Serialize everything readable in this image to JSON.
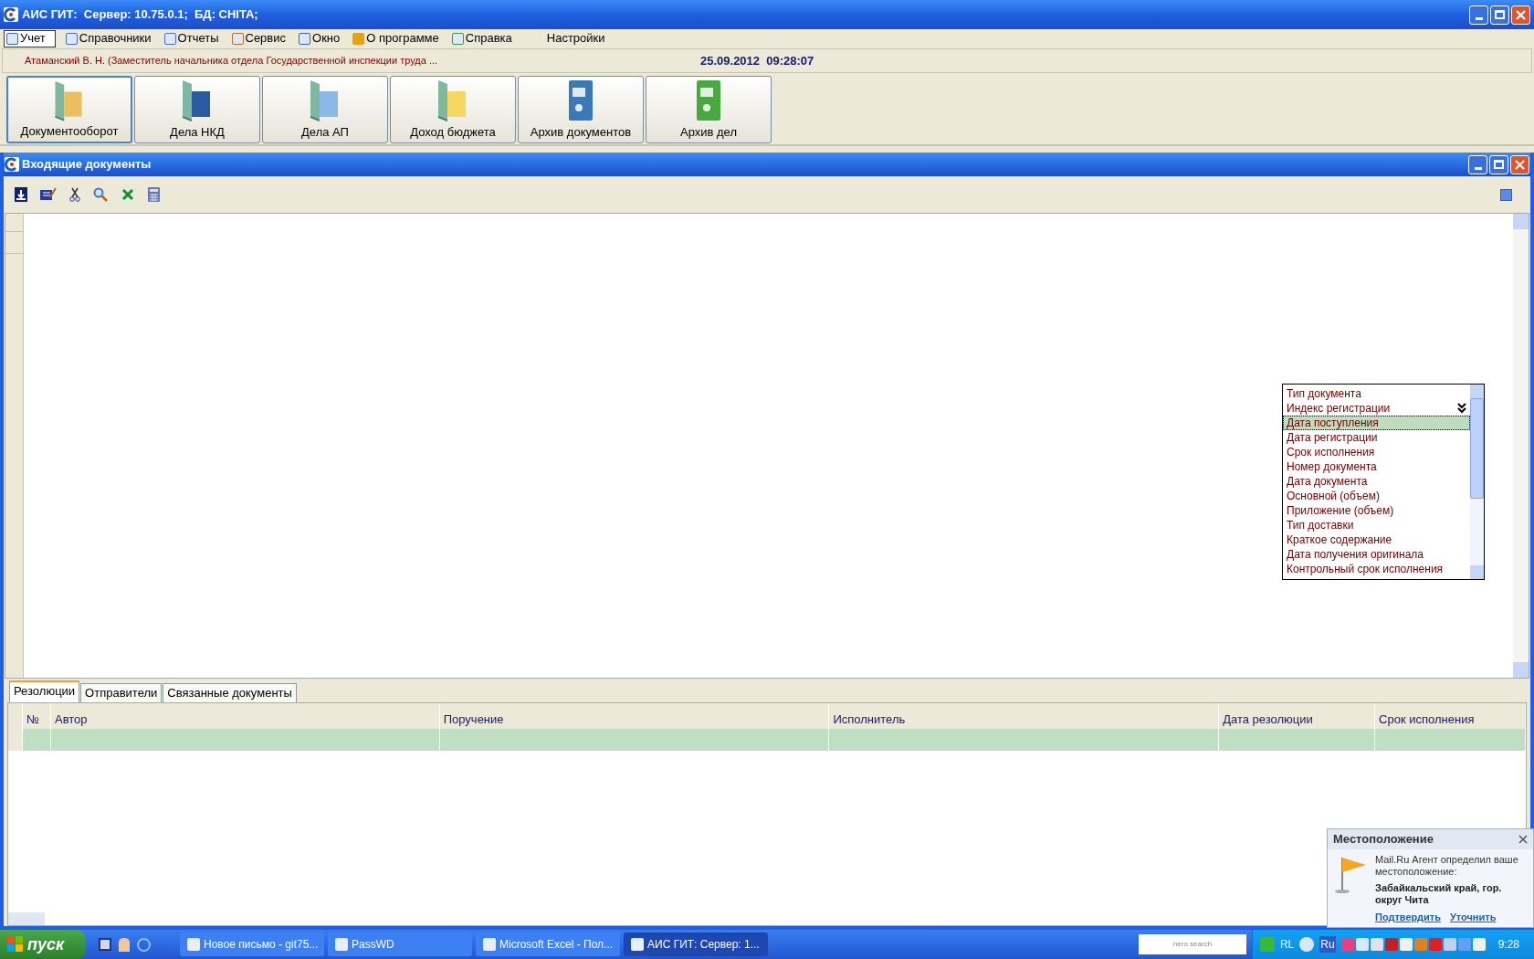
{
  "window": {
    "title": "АИС ГИТ:  Сервер: 10.75.0.1;  БД: CHITA;"
  },
  "menu": [
    {
      "label": "Учет",
      "selected": true
    },
    {
      "label": "Справочники",
      "selected": false
    },
    {
      "label": "Отчеты",
      "selected": false
    },
    {
      "label": "Сервис",
      "selected": false
    },
    {
      "label": "Окно",
      "selected": false
    },
    {
      "label": "О программе",
      "selected": false
    },
    {
      "label": "Справка",
      "selected": false
    },
    {
      "label": "Настройки",
      "selected": false
    }
  ],
  "user_info": "Атаманский В. Н. (Заместитель начальника отдела Государственной инспекции труда ...",
  "datetime": "25.09.2012  09:28:07",
  "modules": [
    {
      "label": "Документооборот",
      "selected": true,
      "kind": "folder-doc"
    },
    {
      "label": "Дела НКД",
      "selected": false,
      "kind": "folder-book"
    },
    {
      "label": "Дела АП",
      "selected": false,
      "kind": "folder-cards"
    },
    {
      "label": "Доход бюджета",
      "selected": false,
      "kind": "folder-yellow"
    },
    {
      "label": "Архив документов",
      "selected": false,
      "kind": "binder-blue"
    },
    {
      "label": "Архив дел",
      "selected": false,
      "kind": "binder-green"
    }
  ],
  "child_window": {
    "title": "Входящие документы"
  },
  "field_list": [
    {
      "label": "Тип документа",
      "selected": false
    },
    {
      "label": "Индекс регистрации",
      "selected": false
    },
    {
      "label": "Дата поступления",
      "selected": true
    },
    {
      "label": "Дата регистрации",
      "selected": false
    },
    {
      "label": "Срок исполнения",
      "selected": false
    },
    {
      "label": "Номер документа",
      "selected": false
    },
    {
      "label": "Дата документа",
      "selected": false
    },
    {
      "label": "Основной (объем)",
      "selected": false
    },
    {
      "label": "Приложение (объем)",
      "selected": false
    },
    {
      "label": "Тип доставки",
      "selected": false
    },
    {
      "label": "Краткое содержание",
      "selected": false
    },
    {
      "label": "Дата получения оригинала",
      "selected": false
    },
    {
      "label": "Контрольный срок исполнения",
      "selected": false
    }
  ],
  "tabs": [
    {
      "label": "Резолюции",
      "selected": true
    },
    {
      "label": "Отправители",
      "selected": false
    },
    {
      "label": "Связанные документы",
      "selected": false
    }
  ],
  "table": {
    "columns": [
      "№",
      "Автор",
      "Поручение",
      "Исполнитель",
      "Дата резолюции",
      "Срок исполнения"
    ]
  },
  "notification": {
    "title": "Местоположение",
    "message": "Mail.Ru Агент определил ваше местоположение:",
    "location": "Забайкальский край, гор. округ Чита",
    "links": [
      "Подтвердить",
      "Уточнить"
    ]
  },
  "taskbar": {
    "start": "пуск",
    "tasks": [
      {
        "label": "Новое письмо - git75...",
        "selected": false
      },
      {
        "label": "PassWD",
        "selected": false
      },
      {
        "label": "Microsoft Excel - Пол...",
        "selected": false
      },
      {
        "label": "АИС ГИТ:  Сервер: 1...",
        "selected": true
      }
    ],
    "search": "nero search",
    "lang": "RL",
    "lang_badge": "Ru",
    "clock": "9:28"
  }
}
